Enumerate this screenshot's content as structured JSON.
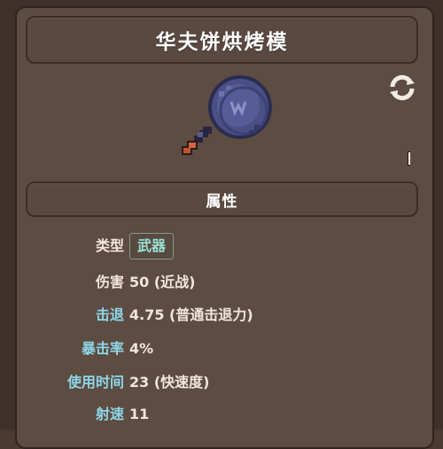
{
  "item": {
    "name": "华夫饼烘烤模"
  },
  "section": {
    "title": "属性"
  },
  "stats": [
    {
      "label": "类型",
      "value": "武器",
      "label_color": "#f2e6da",
      "badge": true
    },
    {
      "label": "伤害",
      "value": "50 (近战)",
      "label_color": "#f2e6da"
    },
    {
      "label": "击退",
      "value": "4.75 (普通击退力)",
      "label_color": "#8fd6e8"
    },
    {
      "label": "暴击率",
      "value": "4%",
      "label_color": "#8fd6e8"
    },
    {
      "label": "使用时间",
      "value": "23 (快速度)",
      "label_color": "#8fd6e8"
    },
    {
      "label": "射速",
      "value": "11",
      "label_color": "#8fd6e8"
    }
  ],
  "icons": {
    "refresh": "refresh-icon",
    "item": "waffle-iron-sprite"
  },
  "colors": {
    "panel": "#5d4c42",
    "frame": "#3e302a",
    "badge_text": "#9ce0d4",
    "label_light": "#f2e6da",
    "label_cyan": "#8fd6e8"
  }
}
